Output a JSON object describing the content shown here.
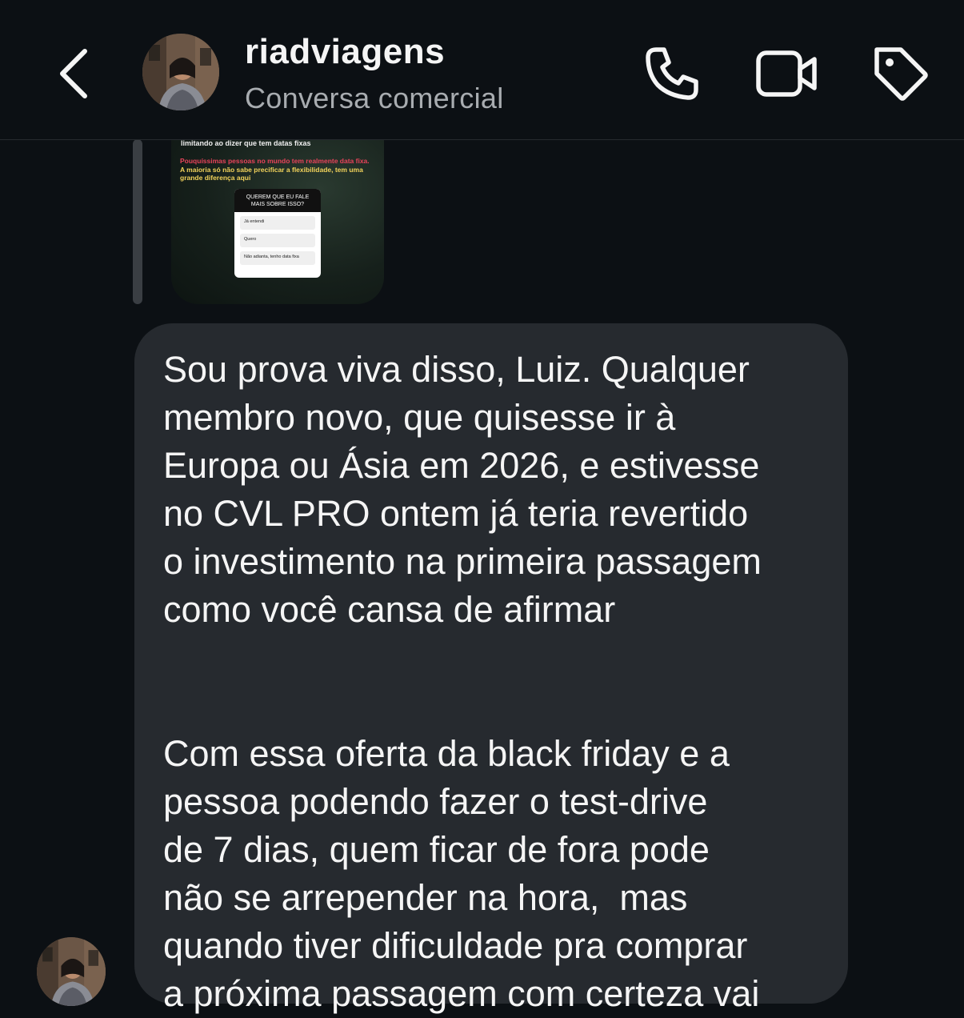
{
  "header": {
    "title": "riadviagens",
    "subtitle": "Conversa comercial",
    "icons": [
      "back-chevron-icon",
      "phone-icon",
      "video-camera-icon",
      "tag-icon"
    ]
  },
  "story": {
    "top_text": "limitando ao dizer que tem datas fixas",
    "red_text": "Pouquíssimas pessoas no mundo tem realmente data fixa.",
    "yellow_text": "A maioria só não sabe precificar a flexibilidade, tem uma grande diferença aqui",
    "poll": {
      "question": "QUEREM QUE EU FALE MAIS SOBRE ISSO?",
      "options": [
        "Já entendi",
        "Quero",
        "Não adianta, tenho data fixa"
      ]
    }
  },
  "message": {
    "text": "Sou prova viva disso, Luiz. Qualquer\nmembro novo, que quisesse ir à\nEuropa ou Ásia em 2026, e estivesse\nno CVL PRO ontem já teria revertido\no investimento na primeira passagem\ncomo você cansa de afirmar\n\n\nCom essa oferta da black friday e a\npessoa podendo fazer o test-drive\nde 7 dias, quem ficar de fora pode\nnão se arrepender na hora,  mas\nquando tiver dificuldade pra comprar\na próxima passagem com certeza vai"
  },
  "colors": {
    "background": "#0c1014",
    "bubble": "#262a2f",
    "subtitle": "#a8acb0",
    "story_red": "#e8435a",
    "story_yellow": "#f2d35b"
  }
}
